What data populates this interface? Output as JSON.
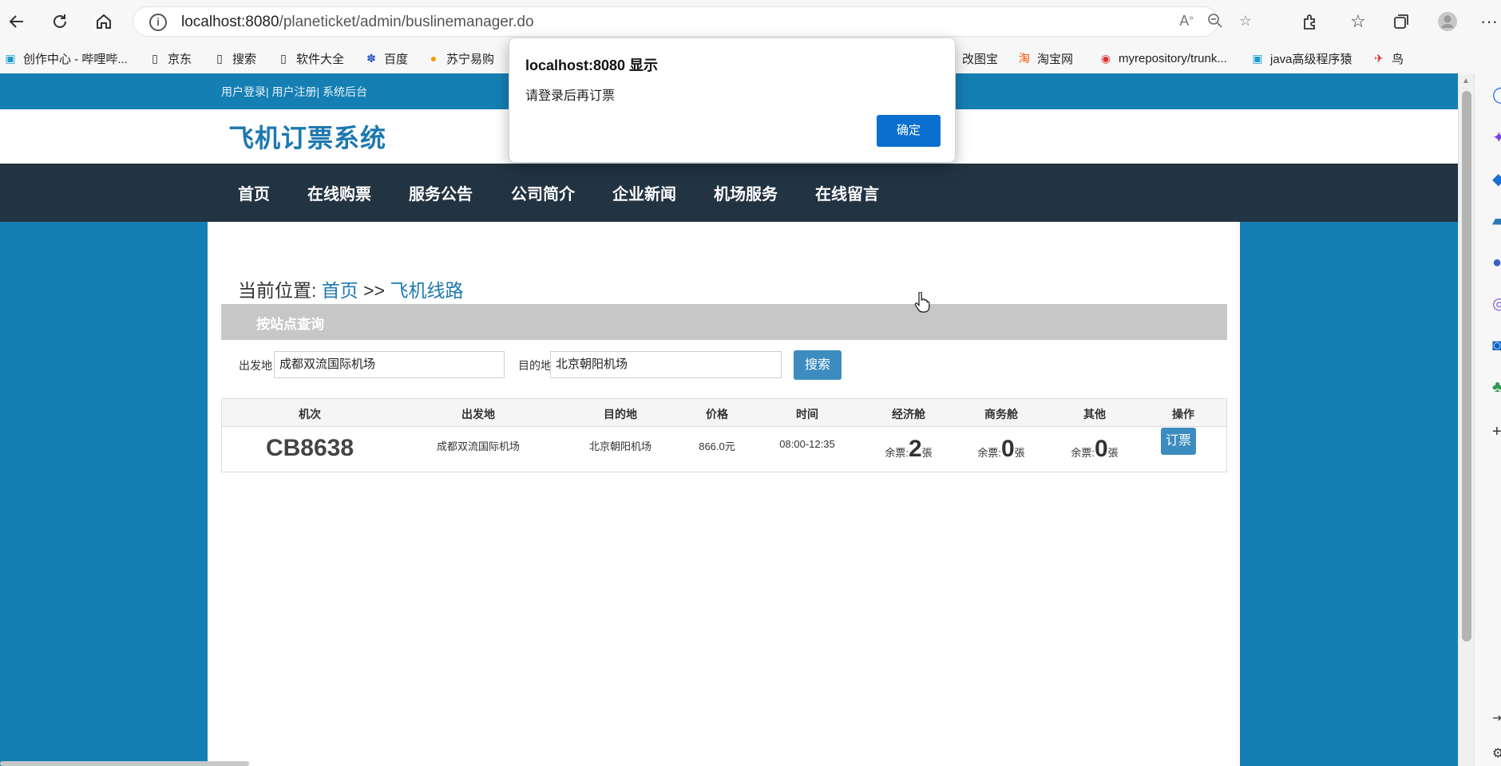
{
  "browser": {
    "url_host": "localhost:8080",
    "url_path": "/planeticket/admin/buslinemanager.do",
    "bookmarks": [
      {
        "label": "创作中心 - 哔哩哔...",
        "icon": "bilibili-icon"
      },
      {
        "label": "京东",
        "icon": "page-icon"
      },
      {
        "label": "搜索",
        "icon": "page-icon"
      },
      {
        "label": "软件大全",
        "icon": "page-icon"
      },
      {
        "label": "百度",
        "icon": "baidu-icon"
      },
      {
        "label": "苏宁易购",
        "icon": "suning-icon"
      },
      {
        "label": "改图宝",
        "icon": "page-icon"
      },
      {
        "label": "淘宝网",
        "icon": "taobao-icon"
      },
      {
        "label": "myrepository/trunk...",
        "icon": "chrome-icon"
      },
      {
        "label": "java高级程序猿",
        "icon": "bilibili-icon"
      },
      {
        "label": "鸟",
        "icon": "bird-icon"
      }
    ]
  },
  "site": {
    "top_links": "用户登录| 用户注册| 系统后台",
    "logo": "飞机订票系统",
    "nav": [
      "首页",
      "在线购票",
      "服务公告",
      "公司简介",
      "企业新闻",
      "机场服务",
      "在线留言"
    ]
  },
  "breadcrumb": {
    "prefix": "当前位置:",
    "home": "首页",
    "sep": ">>",
    "current": "飞机线路"
  },
  "query": {
    "title": "按站点查询",
    "from_label": "出发地",
    "from_value": "成都双流国际机场",
    "to_label": "目的地",
    "to_value": "北京朝阳机场",
    "search_label": "搜索"
  },
  "table": {
    "headers": [
      "机次",
      "出发地",
      "目的地",
      "价格",
      "时间",
      "经济舱",
      "商务舱",
      "其他",
      "操作"
    ],
    "rows": [
      {
        "flight": "CB8638",
        "from": "成都双流国际机场",
        "to": "北京朝阳机场",
        "price": "866.0元",
        "time": "08:00-12:35",
        "remain_prefix": "余票:",
        "remain_unit": "張",
        "economy": "2",
        "business": "0",
        "other": "0",
        "action": "订票"
      }
    ]
  },
  "dialog": {
    "title": "localhost:8080 显示",
    "message": "请登录后再订票",
    "ok": "确定"
  }
}
